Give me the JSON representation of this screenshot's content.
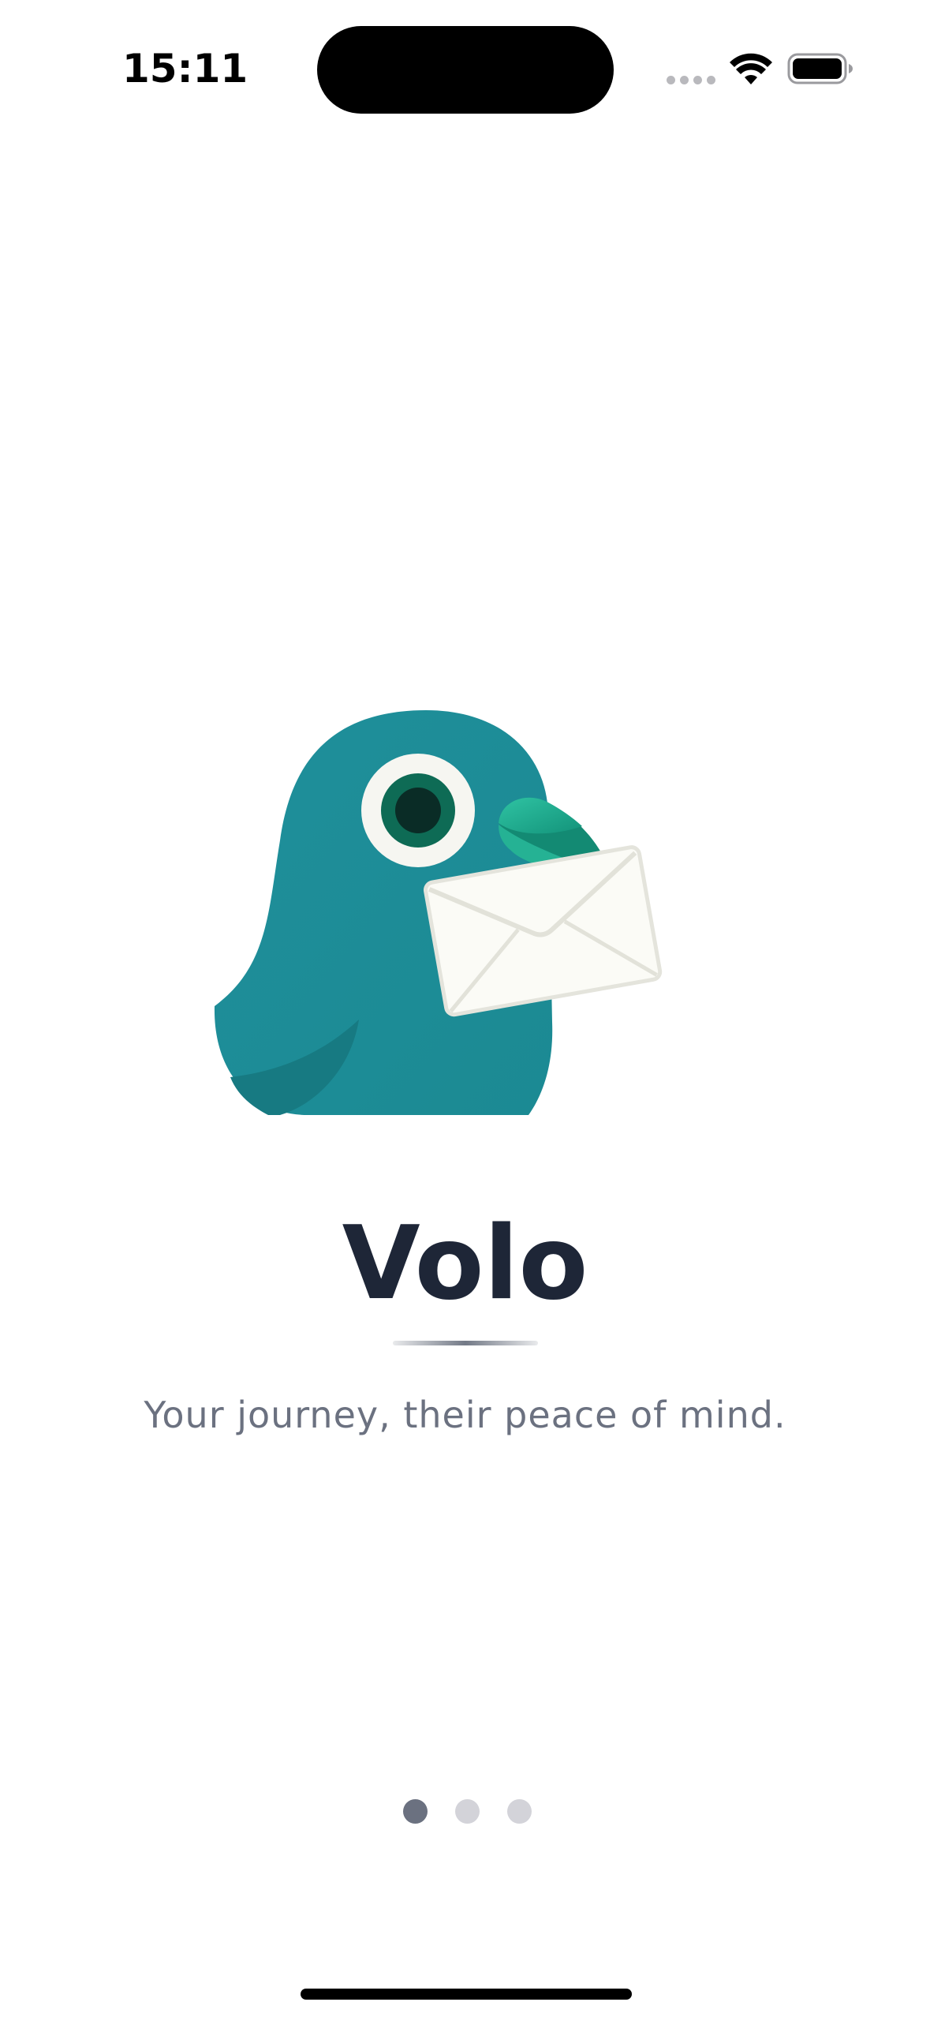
{
  "status_bar": {
    "time": "15:11",
    "icons": [
      "cellular-signal-icon",
      "wifi-icon",
      "battery-icon"
    ]
  },
  "onboarding": {
    "illustration": "pigeon-with-envelope-illustration",
    "title": "Volo",
    "tagline": "Your journey, their peace of mind.",
    "pager": {
      "total": 3,
      "active_index": 0
    }
  },
  "colors": {
    "title": "#1e2637",
    "tagline": "#6b7180",
    "pigeon_body": "#1e8f9a",
    "beak": "#1aa58a",
    "envelope": "#fbfbf6",
    "dot_active": "#6b7180",
    "dot_inactive": "#d3d3d9"
  }
}
